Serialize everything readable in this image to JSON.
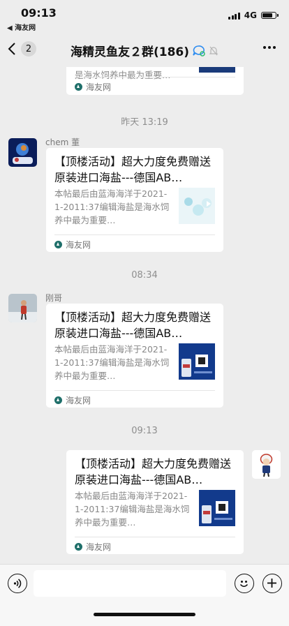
{
  "status_bar": {
    "time": "09:13",
    "back_app": "◀ 海友网",
    "network": "4G"
  },
  "nav": {
    "back_count": "2",
    "title": "海精灵鱼友２群(186)"
  },
  "messages": [
    {
      "type": "card-partial",
      "desc_tail": "是海水饲养中最为重要…",
      "source": "海友网"
    },
    {
      "type": "timestamp",
      "text": "昨天 13:19"
    },
    {
      "type": "card",
      "sender": "chem 董",
      "title": "【顶楼活动】超大力度免费赠送原装进口海盐---德国AB…",
      "desc": "本帖最后由蓝海海洋于2021-1-2011:37编辑海盐是海水饲养中最为重要…",
      "source": "海友网"
    },
    {
      "type": "timestamp",
      "text": "08:34"
    },
    {
      "type": "card",
      "sender": "刚哥",
      "title": "【顶楼活动】超大力度免费赠送原装进口海盐---德国AB…",
      "desc": "本帖最后由蓝海海洋于2021-1-2011:37编辑海盐是海水饲养中最为重要…",
      "source": "海友网"
    },
    {
      "type": "timestamp",
      "text": "09:13"
    },
    {
      "type": "card-self",
      "title": "【顶楼活动】超大力度免费赠送原装进口海盐---德国AB…",
      "desc": "本帖最后由蓝海海洋于2021-1-2011:37编辑海盐是海水饲养中最为重要…",
      "source": "海友网"
    }
  ],
  "input": {
    "value": "",
    "placeholder": ""
  },
  "colors": {
    "background": "#ededed",
    "card": "#ffffff",
    "source_icon": "#1f6f6a"
  }
}
